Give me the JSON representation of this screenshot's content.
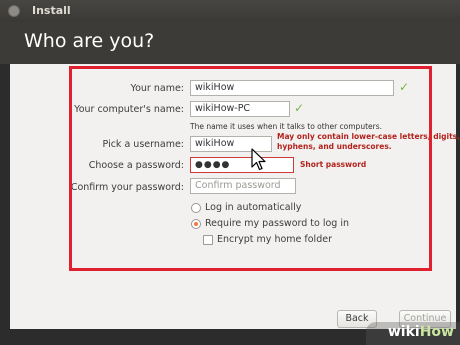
{
  "window": {
    "title": "Install"
  },
  "page": {
    "heading": "Who are you?"
  },
  "form": {
    "name": {
      "label": "Your name:",
      "value": "wikiHow"
    },
    "computer": {
      "label": "Your computer's name:",
      "value": "wikiHow-PC",
      "hint": "The name it uses when it talks to other computers."
    },
    "username": {
      "label": "Pick a username:",
      "value": "wikiHow",
      "warning_line1": "May only contain lower-case letters, digits,",
      "warning_line2": "hyphens, and underscores."
    },
    "password": {
      "label": "Choose a password:",
      "value": "●●●●",
      "strength": "Short password"
    },
    "confirm": {
      "label": "Confirm your password:",
      "placeholder": "Confirm password"
    },
    "options": {
      "autologin": "Log in automatically",
      "require_password": "Require my password to log in",
      "encrypt_home": "Encrypt my home folder"
    }
  },
  "buttons": {
    "back": "Back",
    "continue": "Continue"
  },
  "watermark": {
    "prefix": "wiki",
    "suffix": "How"
  },
  "colors": {
    "highlight_frame": "#e0202e",
    "check": "#7cb342",
    "warning": "#b3231e",
    "radio_selected": "#f07746"
  }
}
